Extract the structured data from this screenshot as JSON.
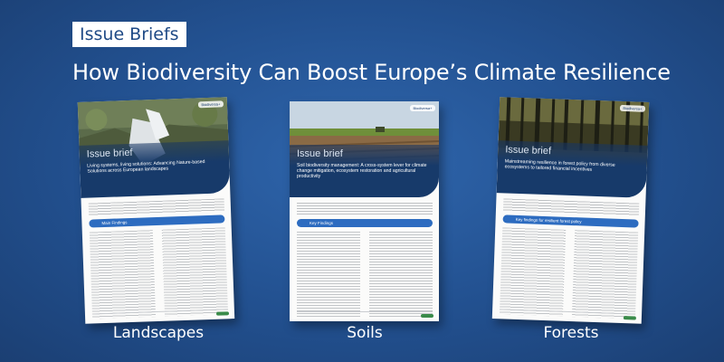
{
  "tag": "Issue Briefs",
  "headline": "How Biodiversity Can Boost Europe’s Climate Resilience",
  "cards": [
    {
      "label": "Landscapes",
      "banner_small": "Issue brief",
      "banner_title": "Living systems, living solutions: Advancing Nature-based Solutions across European landscapes",
      "logo": "Biodiversa+",
      "key_bar": "Main Findings"
    },
    {
      "label": "Soils",
      "banner_small": "Issue brief",
      "banner_title": "Soil biodiversity management: A cross-system lever for climate change mitigation, ecosystem restoration and agricultural productivity",
      "logo": "Biodiversa+",
      "key_bar": "Key Findings"
    },
    {
      "label": "Forests",
      "banner_small": "Issue brief",
      "banner_title": "Mainstreaming resilience in forest policy from diverse ecosystems to tailored financial incentives",
      "logo": "Biodiversa+",
      "key_bar": "Key findings for resilient forest policy"
    }
  ]
}
